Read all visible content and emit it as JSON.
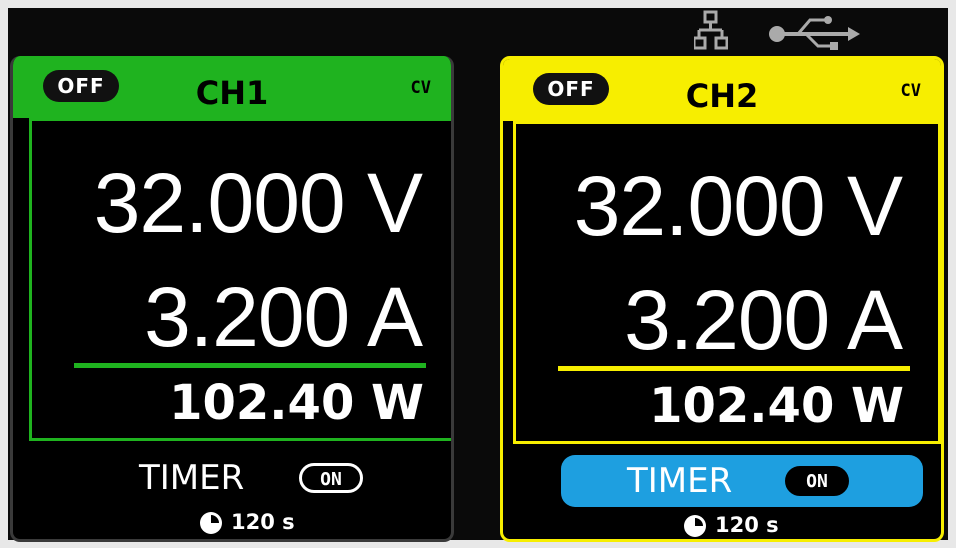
{
  "status": {
    "icons": [
      "lan-icon",
      "usb-icon"
    ]
  },
  "colors": {
    "ch1": "#1fb31f",
    "ch2": "#f7ee00",
    "timer_active": "#1e9fe0"
  },
  "channels": [
    {
      "name": "CH1",
      "output_state": "OFF",
      "mode": "CV",
      "voltage": "32.000 V",
      "current": "3.200 A",
      "power": "102.40  W",
      "timer_label": "TIMER",
      "timer_state": "ON",
      "timer_value": "120 s"
    },
    {
      "name": "CH2",
      "output_state": "OFF",
      "mode": "CV",
      "voltage": "32.000 V",
      "current": "3.200 A",
      "power": "102.40  W",
      "timer_label": "TIMER",
      "timer_state": "ON",
      "timer_value": "120 s"
    }
  ]
}
